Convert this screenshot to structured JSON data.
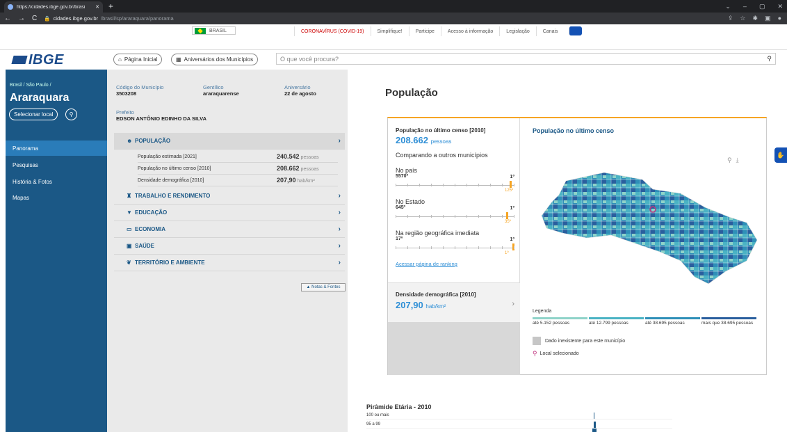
{
  "browser": {
    "tab_title": "https://cidades.ibge.gov.br/brasi",
    "new_tab": "+",
    "url_host": "cidades.ibge.gov.br",
    "url_path": "/brasil/sp/araraquara/panorama",
    "win_controls": [
      "⌄",
      "–",
      "▢",
      "✕"
    ]
  },
  "gov_bar": {
    "brasil": "BRASIL",
    "links": [
      "CORONAVÍRUS (COVID-19)",
      "Simplifique!",
      "Participe",
      "Acesso à informação",
      "Legislação",
      "Canais"
    ]
  },
  "header": {
    "logo": "IBGE",
    "home": "Página Inicial",
    "anniversaries": "Aniversários dos Municípios",
    "search_placeholder": "O que você procura?"
  },
  "sidebar": {
    "breadcrumb": "Brasil / São Paulo /",
    "city": "Araraquara",
    "select_local": "Selecionar local",
    "nav": [
      "Panorama",
      "Pesquisas",
      "História & Fotos",
      "Mapas"
    ]
  },
  "info": {
    "codigo_label": "Código do Município",
    "codigo": "3503208",
    "gentilico_label": "Gentílico",
    "gentilico": "araraquarense",
    "aniversario_label": "Aniversário",
    "aniversario": "22 de agosto",
    "prefeito_label": "Prefeito",
    "prefeito": "EDSON ANTÔNIO EDINHO DA SILVA",
    "sections": [
      "POPULAÇÃO",
      "TRABALHO E RENDIMENTO",
      "EDUCAÇÃO",
      "ECONOMIA",
      "SAÚDE",
      "TERRITÓRIO E AMBIENTE"
    ],
    "population_rows": [
      {
        "label": "População estimada [2021]",
        "value": "240.542",
        "unit": "pessoas"
      },
      {
        "label": "População no último censo [2010]",
        "value": "208.662",
        "unit": "pessoas"
      },
      {
        "label": "Densidade demográfica [2010]",
        "value": "207,90",
        "unit": "hab/km²"
      }
    ],
    "notas": "Notas & Fontes"
  },
  "main": {
    "title": "População",
    "censo_title": "População no último censo [2010]",
    "censo_value": "208.662",
    "censo_unit": "pessoas",
    "comparando": "Comparando a outros municípios",
    "rankings": [
      {
        "label": "No país",
        "total": "5570º",
        "first": "1º",
        "position": "125º",
        "fraction": 0.978
      },
      {
        "label": "No Estado",
        "total": "645º",
        "first": "1º",
        "position": "35º",
        "fraction": 0.947
      },
      {
        "label": "Na região geográfica imediata",
        "total": "17º",
        "first": "1º",
        "position": "1º",
        "fraction": 1.0
      }
    ],
    "acessar": "Acessar página de ranking",
    "densidade_title": "Densidade demográfica [2010]",
    "densidade_value": "207,90",
    "densidade_unit": "hab/km²",
    "map_title": "População no último censo",
    "map_icons": [
      "zoom-icon",
      "download-icon"
    ],
    "legend_title": "Legenda",
    "legend": [
      {
        "label": "até 5.152 pessoas",
        "color": "#8fd3c9"
      },
      {
        "label": "até 12.799 pessoas",
        "color": "#4bb3c4"
      },
      {
        "label": "até 38.695 pessoas",
        "color": "#2f8fb8"
      },
      {
        "label": "mais que 38.695 pessoas",
        "color": "#2a5f9e"
      }
    ],
    "nodata": "Dado inexistente para este município",
    "local": "Local selecionado",
    "pyramid_title": "Pirâmide Etária - 2010",
    "pyramid_rows": [
      "100 ou mais",
      "95 a 99"
    ]
  }
}
